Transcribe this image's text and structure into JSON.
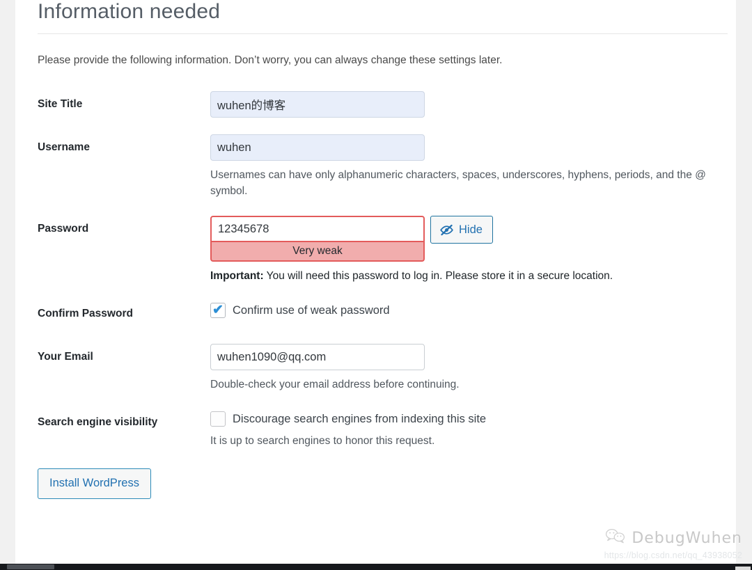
{
  "page": {
    "title": "Information needed",
    "intro": "Please provide the following information. Don’t worry, you can always change these settings later."
  },
  "fields": {
    "site_title": {
      "label": "Site Title",
      "value": "wuhen的博客",
      "placeholder": ""
    },
    "username": {
      "label": "Username",
      "value": "wuhen",
      "placeholder": "",
      "description": "Usernames can have only alphanumeric characters, spaces, underscores, hyphens, periods, and the @ symbol."
    },
    "password": {
      "label": "Password",
      "value": "12345678",
      "placeholder": "",
      "strength": "Very weak",
      "toggle_label": "Hide",
      "toggle_icon": "eye-slash-icon",
      "important_prefix": "Important:",
      "important_text": " You will need this password to log in. Please store it in a secure location."
    },
    "confirm_password": {
      "label": "Confirm Password",
      "checkbox_label": "Confirm use of weak password",
      "checked": true,
      "check_glyph": "✔"
    },
    "email": {
      "label": "Your Email",
      "value": "wuhen1090@qq.com",
      "placeholder": "",
      "description": "Double-check your email address before continuing."
    },
    "search_visibility": {
      "label": "Search engine visibility",
      "checkbox_label": "Discourage search engines from indexing this site",
      "checked": false,
      "description": "It is up to search engines to honor this request."
    }
  },
  "submit": {
    "label": "Install WordPress"
  },
  "watermark": {
    "brand": "DebugWuhen",
    "icon": "wechat-icon",
    "url": "https://blog.csdn.net/qq_43938052"
  },
  "colors": {
    "accent": "#2271b1",
    "error": "#e35b5b",
    "strength_bg": "#f1adad",
    "autofill_bg": "#e8eefa",
    "heading": "#555d66",
    "page_bg": "#f1f1f1"
  }
}
